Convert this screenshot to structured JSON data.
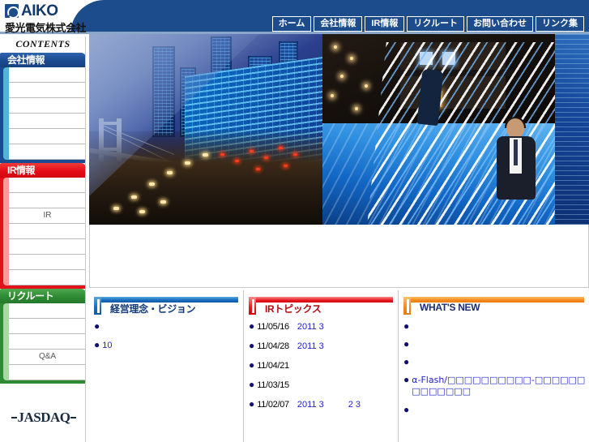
{
  "header": {
    "logo_en": "AIKO",
    "logo_jp": "愛光電気株式会社",
    "logo_mark_name": "aiko-logo-mark"
  },
  "nav": {
    "items": [
      {
        "label": "ホーム"
      },
      {
        "label": "会社情報"
      },
      {
        "label": "IR情報"
      },
      {
        "label": "リクルート"
      },
      {
        "label": "お問い合わせ"
      },
      {
        "label": "リンク集"
      }
    ]
  },
  "sidebar": {
    "contents_title": "CONTENTS",
    "sections": [
      {
        "heading": "会社情報",
        "color": "#1a4a90",
        "items": [
          {
            "label": ""
          },
          {
            "label": ""
          },
          {
            "label": ""
          },
          {
            "label": ""
          },
          {
            "label": ""
          },
          {
            "label": ""
          }
        ]
      },
      {
        "heading": "IR情報",
        "color": "#e2121a",
        "items": [
          {
            "label": ""
          },
          {
            "label": ""
          },
          {
            "label": "IR"
          },
          {
            "label": ""
          },
          {
            "label": ""
          },
          {
            "label": ""
          },
          {
            "label": ""
          }
        ]
      },
      {
        "heading": "リクルート",
        "color": "#2e8b33",
        "items": [
          {
            "label": ""
          },
          {
            "label": ""
          },
          {
            "label": ""
          },
          {
            "label": "Q&A"
          },
          {
            "label": ""
          }
        ]
      }
    ],
    "jasdaq_label": "JASDAQ"
  },
  "hero": {
    "alt": "都市夜景・レインボーブリッジ・交通・ビジネスイメージのコラージュ"
  },
  "boxes": [
    {
      "title": "経営理念・ビジョン",
      "accent": "#1a6fc0",
      "items": [
        {
          "date": "",
          "link": ""
        },
        {
          "date": "",
          "link": "10"
        }
      ]
    },
    {
      "title": "IRトピックス",
      "accent": "#e8181f",
      "items": [
        {
          "date": "11/05/16",
          "link": "2011 3",
          "link2": ""
        },
        {
          "date": "11/04/28",
          "link": "2011 3",
          "link2": ""
        },
        {
          "date": "11/04/21",
          "link": "",
          "link2": ""
        },
        {
          "date": "11/03/15",
          "link": "",
          "link2": ""
        },
        {
          "date": "11/02/07",
          "link": "2011 3",
          "link2": "2 3"
        }
      ]
    },
    {
      "title": "WHAT'S NEW",
      "accent": "#f4881d",
      "items": [
        {
          "text": ""
        },
        {
          "text": ""
        },
        {
          "text": ""
        },
        {
          "text": "α-Flash/□□□□□□□□□□-□□□□□□□□□□□□□"
        },
        {
          "text": ""
        }
      ]
    }
  ]
}
